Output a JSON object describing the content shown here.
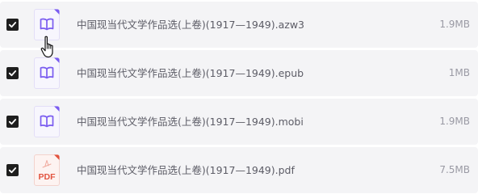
{
  "files": [
    {
      "name": "中国现当代文学作品选(上卷)(1917—1949).azw3",
      "size": "1.9MB",
      "selected": true,
      "icon": "ebook-icon"
    },
    {
      "name": "中国现当代文学作品选(上卷)(1917—1949).epub",
      "size": "1MB",
      "selected": true,
      "icon": "ebook-icon"
    },
    {
      "name": "中国现当代文学作品选(上卷)(1917—1949).mobi",
      "size": "1.9MB",
      "selected": true,
      "icon": "ebook-icon"
    },
    {
      "name": "中国现当代文学作品选(上卷)(1917—1949).pdf",
      "size": "7.5MB",
      "selected": true,
      "icon": "pdf-icon",
      "icon_label": "PDF"
    }
  ],
  "colors": {
    "row_background": "#f4f4f6",
    "ebook_accent": "#7a5cf0",
    "pdf_accent": "#e2533f",
    "checkbox": "#1e1e1e"
  }
}
